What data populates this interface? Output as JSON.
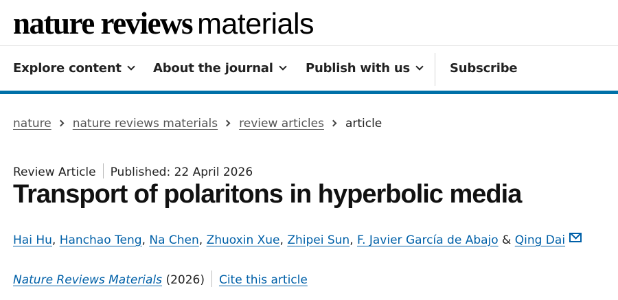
{
  "masthead": {
    "brand": "nature",
    "reviews": "reviews",
    "title": "materials"
  },
  "nav": {
    "items": [
      {
        "label": "Explore content"
      },
      {
        "label": "About the journal"
      },
      {
        "label": "Publish with us"
      },
      {
        "label": "Subscribe"
      }
    ]
  },
  "breadcrumb": {
    "items": [
      {
        "label": "nature"
      },
      {
        "label": "nature reviews materials"
      },
      {
        "label": "review articles"
      },
      {
        "label": "article"
      }
    ]
  },
  "article": {
    "type": "Review Article",
    "published": "Published: 22 April 2026",
    "title": "Transport of polaritons in hyperbolic media",
    "authors": [
      "Hai Hu",
      "Hanchao Teng",
      "Na Chen",
      "Zhuoxin Xue",
      "Zhipei Sun",
      "F. Javier García de Abajo",
      "Qing Dai"
    ],
    "journal": "Nature Reviews Materials",
    "year": "(2026)",
    "cite_label": "Cite this article"
  },
  "colors": {
    "accent": "#0070a8",
    "link": "#0060a8"
  }
}
